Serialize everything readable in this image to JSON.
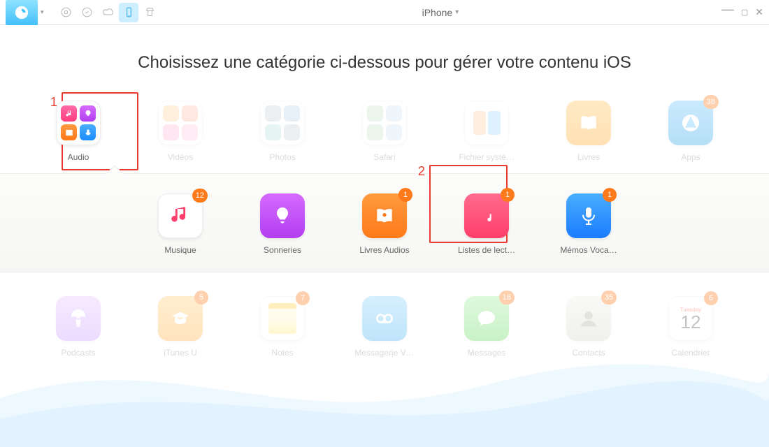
{
  "device_selector": "iPhone",
  "headline": "Choisissez une catégorie ci-dessous pour gérer votre contenu iOS",
  "annotations": {
    "one": "1",
    "two": "2"
  },
  "categories_row1": [
    {
      "label": "Audio",
      "type": "grid",
      "badge": null
    },
    {
      "label": "Vidéos",
      "type": "grid",
      "badge": null
    },
    {
      "label": "Photos",
      "type": "grid",
      "badge": null
    },
    {
      "label": "Safari",
      "type": "grid",
      "badge": null
    },
    {
      "label": "Fichier systè…",
      "type": "grid",
      "badge": null
    },
    {
      "label": "Livres",
      "type": "solid",
      "badge": null
    },
    {
      "label": "Apps",
      "type": "solid",
      "badge": 38
    }
  ],
  "categories_row2": [
    {
      "label": "Musique",
      "badge": 12
    },
    {
      "label": "Sonneries",
      "badge": null
    },
    {
      "label": "Livres Audios",
      "badge": 1
    },
    {
      "label": "Listes de lect…",
      "badge": 1
    },
    {
      "label": "Mémos Voca…",
      "badge": 1
    }
  ],
  "categories_row3": [
    {
      "label": "Podcasts",
      "badge": null
    },
    {
      "label": "iTunes U",
      "badge": 5
    },
    {
      "label": "Notes",
      "badge": 7
    },
    {
      "label": "Messagerie V…",
      "badge": null
    },
    {
      "label": "Messages",
      "badge": 16
    },
    {
      "label": "Contacts",
      "badge": 35
    },
    {
      "label": "Calendrier",
      "badge": 6,
      "extra": {
        "day": "Tuesday",
        "date": "12"
      }
    }
  ]
}
